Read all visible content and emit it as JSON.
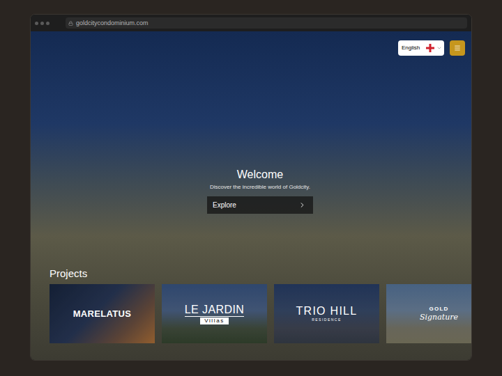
{
  "browser": {
    "address": "goldcitycondominium.com"
  },
  "header": {
    "language": "English"
  },
  "hero": {
    "title": "Welcome",
    "subtitle": "Discover the incredible world of Goldcity.",
    "button": "Explore"
  },
  "projects": {
    "title": "Projects",
    "items": [
      {
        "name": "MARELATUS",
        "kind": "plain"
      },
      {
        "name": "LE JARDIN",
        "sub": "Villas",
        "kind": "boxed"
      },
      {
        "name": "TRIO HILL",
        "sub": "RESIDENCE",
        "kind": "spaced"
      },
      {
        "name": "GOLD",
        "sub": "Signature",
        "kind": "script"
      }
    ]
  }
}
